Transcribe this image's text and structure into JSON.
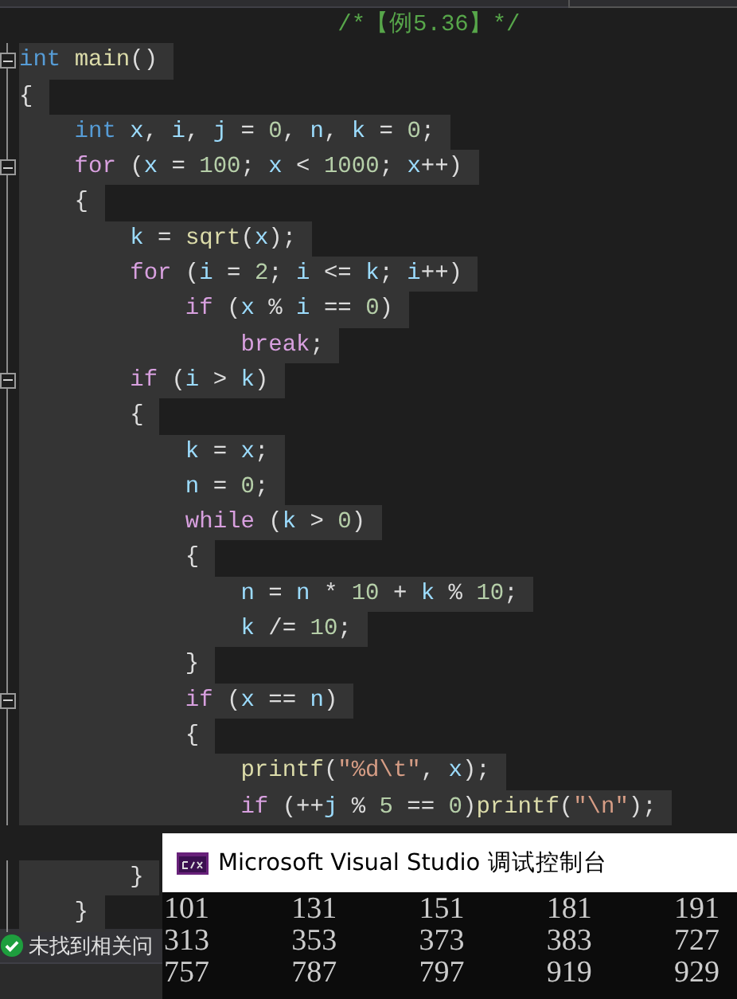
{
  "editor": {
    "lines": [
      {
        "fold": false,
        "selected": false,
        "tokens": [
          {
            "kind": "cm",
            "text": "                       /*【例5.36】*/"
          }
        ]
      },
      {
        "fold": true,
        "selected": true,
        "tokens": [
          {
            "kind": "kw",
            "text": "int "
          },
          {
            "kind": "fn",
            "text": "main"
          },
          {
            "kind": "op",
            "text": "()"
          }
        ]
      },
      {
        "fold": false,
        "selected": true,
        "tokens": [
          {
            "kind": "op",
            "text": "{"
          }
        ]
      },
      {
        "fold": false,
        "selected": true,
        "tokens": [
          {
            "kind": "kw",
            "text": "    int "
          },
          {
            "kind": "var",
            "text": "x"
          },
          {
            "kind": "op",
            "text": ", "
          },
          {
            "kind": "var",
            "text": "i"
          },
          {
            "kind": "op",
            "text": ", "
          },
          {
            "kind": "var",
            "text": "j"
          },
          {
            "kind": "op",
            "text": " = "
          },
          {
            "kind": "num",
            "text": "0"
          },
          {
            "kind": "op",
            "text": ", "
          },
          {
            "kind": "var",
            "text": "n"
          },
          {
            "kind": "op",
            "text": ", "
          },
          {
            "kind": "var",
            "text": "k"
          },
          {
            "kind": "op",
            "text": " = "
          },
          {
            "kind": "num",
            "text": "0"
          },
          {
            "kind": "op",
            "text": ";"
          }
        ]
      },
      {
        "fold": true,
        "selected": true,
        "tokens": [
          {
            "kind": "ctl",
            "text": "    for"
          },
          {
            "kind": "op",
            "text": " ("
          },
          {
            "kind": "var",
            "text": "x"
          },
          {
            "kind": "op",
            "text": " = "
          },
          {
            "kind": "num",
            "text": "100"
          },
          {
            "kind": "op",
            "text": "; "
          },
          {
            "kind": "var",
            "text": "x"
          },
          {
            "kind": "op",
            "text": " < "
          },
          {
            "kind": "num",
            "text": "1000"
          },
          {
            "kind": "op",
            "text": "; "
          },
          {
            "kind": "var",
            "text": "x"
          },
          {
            "kind": "op",
            "text": "++)"
          }
        ]
      },
      {
        "fold": false,
        "selected": true,
        "tokens": [
          {
            "kind": "op",
            "text": "    {"
          }
        ]
      },
      {
        "fold": false,
        "selected": true,
        "tokens": [
          {
            "kind": "var",
            "text": "        k"
          },
          {
            "kind": "op",
            "text": " = "
          },
          {
            "kind": "fn",
            "text": "sqrt"
          },
          {
            "kind": "op",
            "text": "("
          },
          {
            "kind": "var",
            "text": "x"
          },
          {
            "kind": "op",
            "text": ");"
          }
        ]
      },
      {
        "fold": false,
        "selected": true,
        "tokens": [
          {
            "kind": "ctl",
            "text": "        for"
          },
          {
            "kind": "op",
            "text": " ("
          },
          {
            "kind": "var",
            "text": "i"
          },
          {
            "kind": "op",
            "text": " = "
          },
          {
            "kind": "num",
            "text": "2"
          },
          {
            "kind": "op",
            "text": "; "
          },
          {
            "kind": "var",
            "text": "i"
          },
          {
            "kind": "op",
            "text": " <= "
          },
          {
            "kind": "var",
            "text": "k"
          },
          {
            "kind": "op",
            "text": "; "
          },
          {
            "kind": "var",
            "text": "i"
          },
          {
            "kind": "op",
            "text": "++)"
          }
        ]
      },
      {
        "fold": false,
        "selected": true,
        "tokens": [
          {
            "kind": "ctl",
            "text": "            if"
          },
          {
            "kind": "op",
            "text": " ("
          },
          {
            "kind": "var",
            "text": "x"
          },
          {
            "kind": "op",
            "text": " % "
          },
          {
            "kind": "var",
            "text": "i"
          },
          {
            "kind": "op",
            "text": " == "
          },
          {
            "kind": "num",
            "text": "0"
          },
          {
            "kind": "op",
            "text": ")"
          }
        ]
      },
      {
        "fold": false,
        "selected": true,
        "tokens": [
          {
            "kind": "ctl",
            "text": "                break"
          },
          {
            "kind": "op",
            "text": ";"
          }
        ]
      },
      {
        "fold": true,
        "selected": true,
        "tokens": [
          {
            "kind": "ctl",
            "text": "        if"
          },
          {
            "kind": "op",
            "text": " ("
          },
          {
            "kind": "var",
            "text": "i"
          },
          {
            "kind": "op",
            "text": " > "
          },
          {
            "kind": "var",
            "text": "k"
          },
          {
            "kind": "op",
            "text": ")"
          }
        ]
      },
      {
        "fold": false,
        "selected": true,
        "tokens": [
          {
            "kind": "op",
            "text": "        {"
          }
        ]
      },
      {
        "fold": false,
        "selected": true,
        "tokens": [
          {
            "kind": "var",
            "text": "            k"
          },
          {
            "kind": "op",
            "text": " = "
          },
          {
            "kind": "var",
            "text": "x"
          },
          {
            "kind": "op",
            "text": ";"
          }
        ]
      },
      {
        "fold": false,
        "selected": true,
        "tokens": [
          {
            "kind": "var",
            "text": "            n"
          },
          {
            "kind": "op",
            "text": " = "
          },
          {
            "kind": "num",
            "text": "0"
          },
          {
            "kind": "op",
            "text": ";"
          }
        ]
      },
      {
        "fold": false,
        "selected": true,
        "tokens": [
          {
            "kind": "ctl",
            "text": "            while"
          },
          {
            "kind": "op",
            "text": " ("
          },
          {
            "kind": "var",
            "text": "k"
          },
          {
            "kind": "op",
            "text": " > "
          },
          {
            "kind": "num",
            "text": "0"
          },
          {
            "kind": "op",
            "text": ")"
          }
        ]
      },
      {
        "fold": false,
        "selected": true,
        "tokens": [
          {
            "kind": "op",
            "text": "            {"
          }
        ]
      },
      {
        "fold": false,
        "selected": true,
        "tokens": [
          {
            "kind": "var",
            "text": "                n"
          },
          {
            "kind": "op",
            "text": " = "
          },
          {
            "kind": "var",
            "text": "n"
          },
          {
            "kind": "op",
            "text": " * "
          },
          {
            "kind": "num",
            "text": "10"
          },
          {
            "kind": "op",
            "text": " + "
          },
          {
            "kind": "var",
            "text": "k"
          },
          {
            "kind": "op",
            "text": " % "
          },
          {
            "kind": "num",
            "text": "10"
          },
          {
            "kind": "op",
            "text": ";"
          }
        ]
      },
      {
        "fold": false,
        "selected": true,
        "tokens": [
          {
            "kind": "var",
            "text": "                k"
          },
          {
            "kind": "op",
            "text": " /= "
          },
          {
            "kind": "num",
            "text": "10"
          },
          {
            "kind": "op",
            "text": ";"
          }
        ]
      },
      {
        "fold": false,
        "selected": true,
        "tokens": [
          {
            "kind": "op",
            "text": "            }"
          }
        ]
      },
      {
        "fold": true,
        "selected": true,
        "tokens": [
          {
            "kind": "ctl",
            "text": "            if"
          },
          {
            "kind": "op",
            "text": " ("
          },
          {
            "kind": "var",
            "text": "x"
          },
          {
            "kind": "op",
            "text": " == "
          },
          {
            "kind": "var",
            "text": "n"
          },
          {
            "kind": "op",
            "text": ")"
          }
        ]
      },
      {
        "fold": false,
        "selected": true,
        "tokens": [
          {
            "kind": "op",
            "text": "            {"
          }
        ]
      },
      {
        "fold": false,
        "selected": true,
        "tokens": [
          {
            "kind": "fn",
            "text": "                printf"
          },
          {
            "kind": "op",
            "text": "("
          },
          {
            "kind": "str",
            "text": "″%d\\t″"
          },
          {
            "kind": "op",
            "text": ", "
          },
          {
            "kind": "var",
            "text": "x"
          },
          {
            "kind": "op",
            "text": ");"
          }
        ]
      },
      {
        "fold": false,
        "selected": true,
        "tokens": [
          {
            "kind": "ctl",
            "text": "                if"
          },
          {
            "kind": "op",
            "text": " (++"
          },
          {
            "kind": "var",
            "text": "j"
          },
          {
            "kind": "op",
            "text": " % "
          },
          {
            "kind": "num",
            "text": "5"
          },
          {
            "kind": "op",
            "text": " == "
          },
          {
            "kind": "num",
            "text": "0"
          },
          {
            "kind": "op",
            "text": ")"
          },
          {
            "kind": "fn",
            "text": "printf"
          },
          {
            "kind": "op",
            "text": "("
          },
          {
            "kind": "str",
            "text": "″\\n″"
          },
          {
            "kind": "op",
            "text": ");"
          }
        ]
      },
      {
        "fold": false,
        "selected": true,
        "tokens": [
          {
            "kind": "op",
            "text": "        }"
          }
        ]
      },
      {
        "fold": false,
        "selected": true,
        "tokens": [
          {
            "kind": "op",
            "text": "    }"
          }
        ]
      }
    ]
  },
  "status_bar": {
    "message": "未找到相关问"
  },
  "console": {
    "title": "Microsoft Visual Studio 调试控制台",
    "rows": [
      [
        "101",
        "131",
        "151",
        "181",
        "191"
      ],
      [
        "313",
        "353",
        "373",
        "383",
        "727"
      ],
      [
        "757",
        "787",
        "797",
        "919",
        "929"
      ]
    ]
  }
}
